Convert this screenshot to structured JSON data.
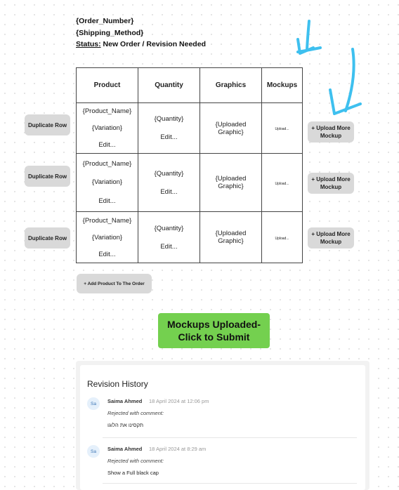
{
  "header": {
    "order_number": "{Order_Number}",
    "shipping_method": "{Shipping_Method}",
    "status_label": "Status:",
    "status_value": "New Order / Revision Needed"
  },
  "table": {
    "columns": [
      "Product",
      "Quantity",
      "Graphics",
      "Mockups"
    ],
    "rows": [
      {
        "product_name": "{Product_Name}",
        "variation": "{Variation}",
        "edit": "Edit...",
        "quantity": "{Quantity}",
        "quantity_edit": "Edit...",
        "graphic": "{Uploaded Graphic}",
        "mockup": "Upload..."
      },
      {
        "product_name": "{Product_Name}",
        "variation": "{Variation}",
        "edit": "Edit...",
        "quantity": "{Quantity}",
        "quantity_edit": "Edit...",
        "graphic": "{Uploaded Graphic}",
        "mockup": "Upload..."
      },
      {
        "product_name": "{Product_Name}",
        "variation": "{Variation}",
        "edit": "Edit...",
        "quantity": "{Quantity}",
        "quantity_edit": "Edit...",
        "graphic": "{Uploaded Graphic}",
        "mockup": "Upload..."
      }
    ]
  },
  "buttons": {
    "duplicate_row": "Duplicate Row",
    "upload_more_mockup": "+ Upload More Mockup",
    "add_product": "+ Add Product To The Order",
    "submit": "Mockups Uploaded- Click to Submit"
  },
  "revision_history": {
    "title": "Revision History",
    "entries": [
      {
        "initials": "Sa",
        "name": "Saima Ahmed",
        "timestamp": "18 April 2024 at 12:06 pm",
        "label": "Rejected with comment:",
        "comment": "תקסינו את הלוגו"
      },
      {
        "initials": "Sa",
        "name": "Saima Ahmed",
        "timestamp": "18 April 2024 at 8:29 am",
        "label": "Rejected with comment:",
        "comment": "Show a Full black cap"
      }
    ]
  },
  "colors": {
    "submit_green": "#74d04f",
    "arrow_blue": "#3ec0ef",
    "button_gray": "#d9d9d9"
  }
}
